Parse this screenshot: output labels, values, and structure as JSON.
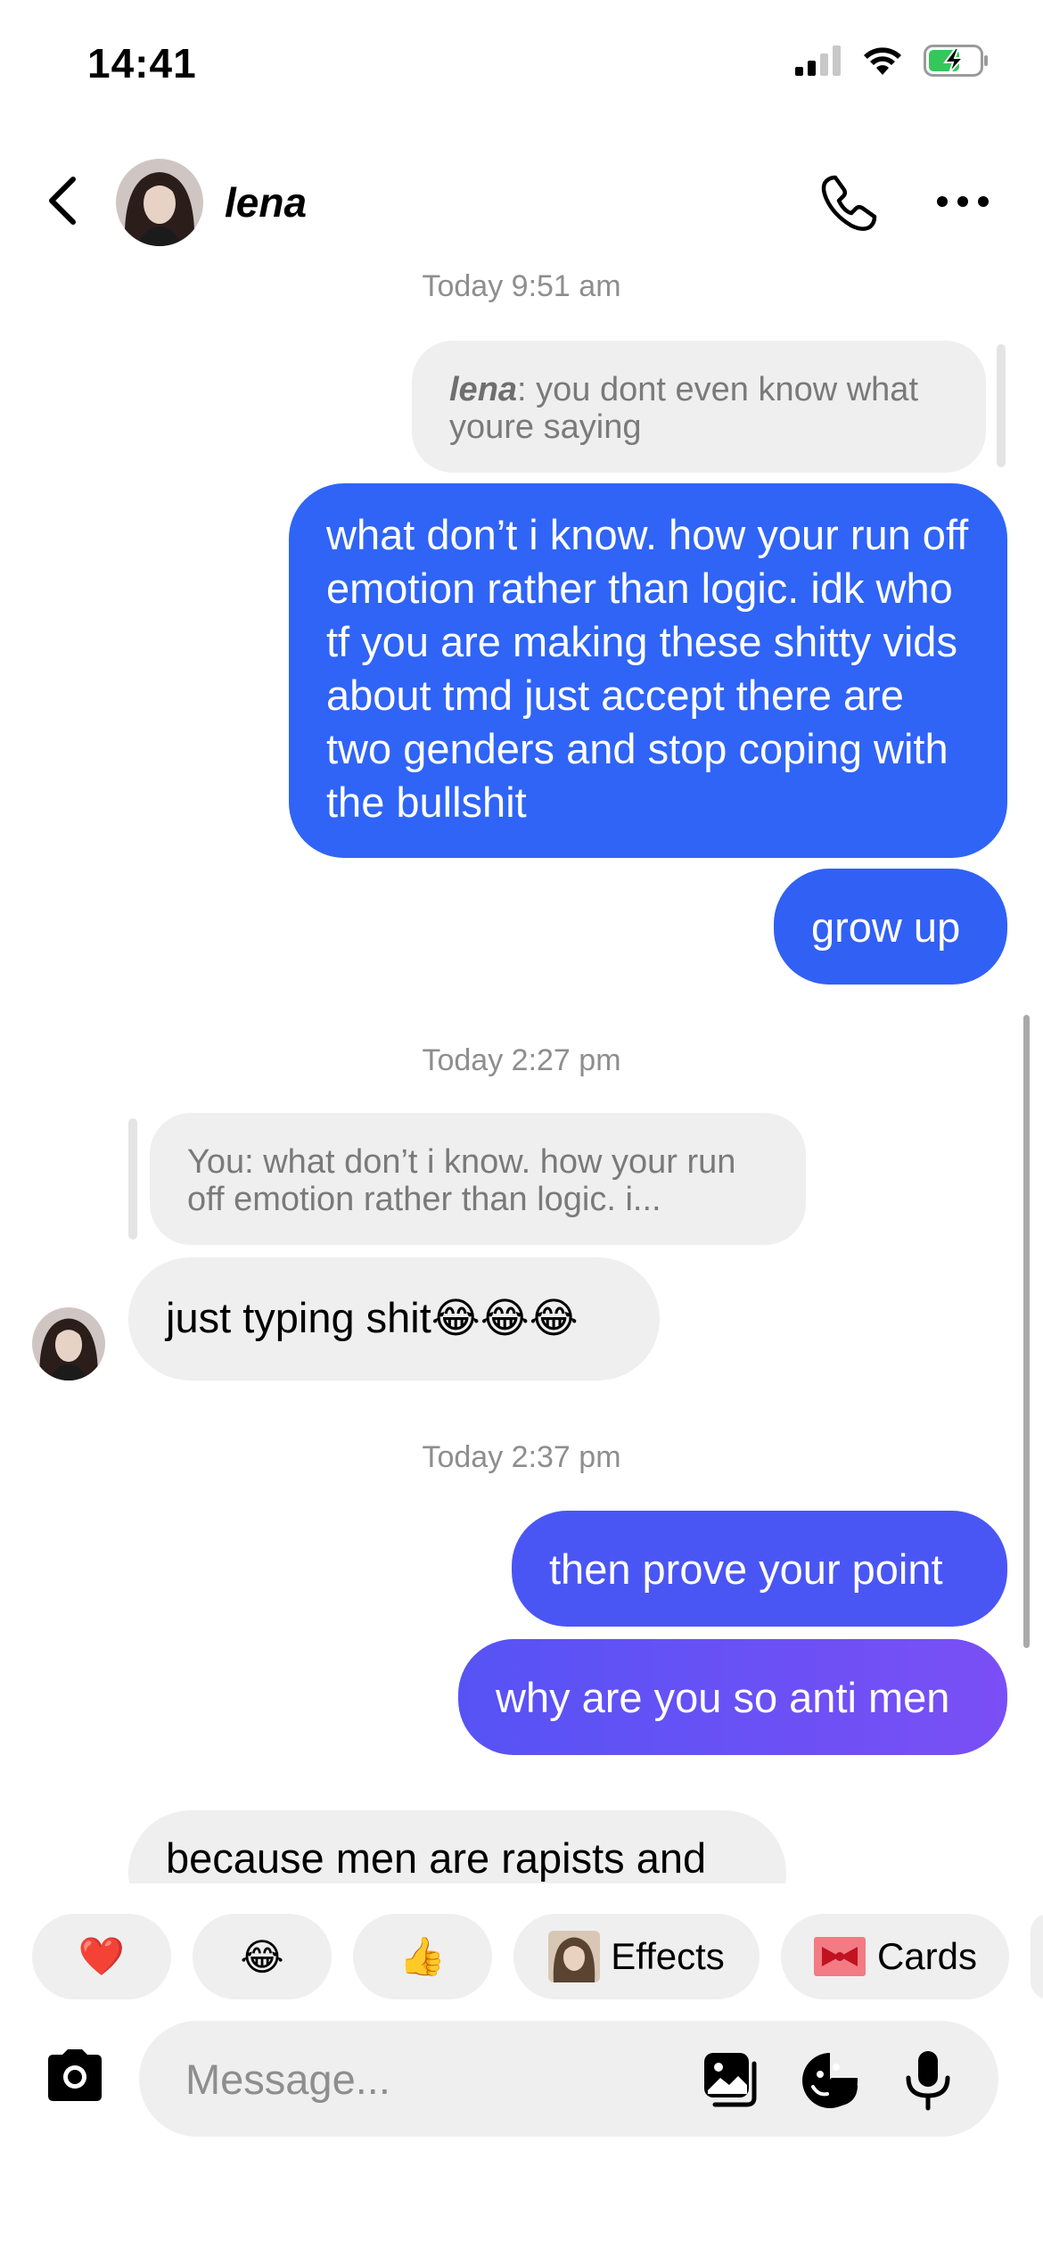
{
  "status_bar": {
    "time": "14:41"
  },
  "header": {
    "contact_name": "lena"
  },
  "messages": {
    "ts1": "Today 9:51 am",
    "quote1_author": "lena",
    "quote1_text": ": you dont even know what youre saying",
    "out1": "what don’t i know. how your run off emotion rather than logic. idk who tf you are making these shitty vids about tmd just accept there are two genders and stop coping with the bullshit",
    "out2": "grow up",
    "ts2": "Today 2:27 pm",
    "quote2": "You: what don’t i know. how your run off emotion rather than logic. i...",
    "in1": "just typing shit😂😂😂",
    "ts3": "Today 2:37 pm",
    "out3": "then prove your point",
    "out4": "why are you so anti men",
    "in2": "because men are rapists and"
  },
  "reactions": {
    "heart": "❤️",
    "laugh": "😂",
    "thumbs": "👍",
    "effects_label": "Effects",
    "cards_label": "Cards"
  },
  "composer": {
    "placeholder": "Message..."
  },
  "colors": {
    "bubble_blue": "#3b5cf7",
    "bubble_blue_bright": "#2f64f6",
    "bubble_purple": "#6c4ef5",
    "battery_green": "#34c759"
  }
}
